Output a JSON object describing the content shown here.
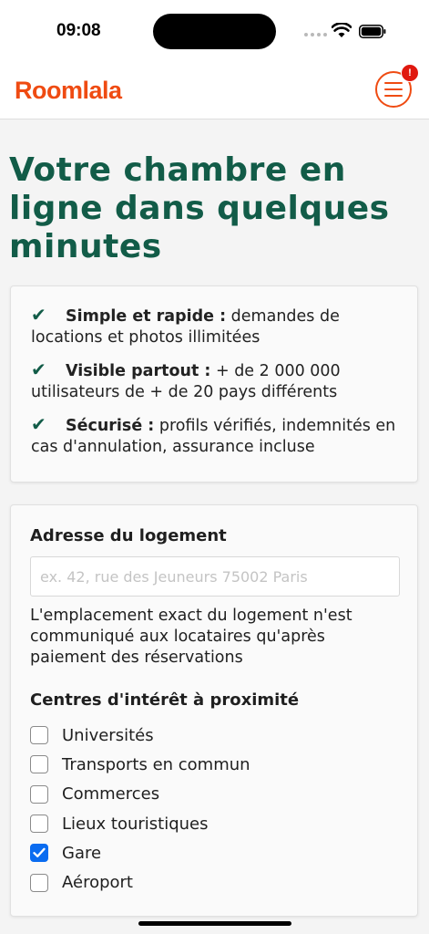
{
  "status_bar": {
    "time": "09:08"
  },
  "header": {
    "logo_text": "Roomlala",
    "notification_count": "!",
    "brand_color": "#ef4b12"
  },
  "page": {
    "title": "Votre chambre en ligne dans quelques minutes",
    "title_color": "#125c48"
  },
  "features": [
    {
      "check": "✔",
      "bold": "Simple et rapide :",
      "text": " demandes de locations et photos illimitées"
    },
    {
      "check": "✔",
      "bold": "Visible partout :",
      "text": " + de 2 000 000 utilisateurs de + de 20 pays différents"
    },
    {
      "check": "✔",
      "bold": "Sécurisé :",
      "text": " profils vérifiés, indemnités en cas d'annulation, assurance incluse"
    }
  ],
  "form": {
    "address_label": "Adresse du logement",
    "address_value": "",
    "address_placeholder": "ex. 42, rue des Jeuneurs 75002 Paris",
    "address_help": "L'emplacement exact du logement n'est communiqué aux locataires qu'après paiement des réservations",
    "poi_label": "Centres d'intérêt à proximité",
    "poi_options": [
      {
        "label": "Universités",
        "checked": false
      },
      {
        "label": "Transports en commun",
        "checked": false
      },
      {
        "label": "Commerces",
        "checked": false
      },
      {
        "label": "Lieux touristiques",
        "checked": false
      },
      {
        "label": "Gare",
        "checked": true
      },
      {
        "label": "Aéroport",
        "checked": false
      }
    ]
  },
  "icons": {
    "menu": "hamburger-icon",
    "wifi": "wifi-icon",
    "battery": "battery-icon",
    "checkmark": "checkmark-icon"
  },
  "colors": {
    "checkbox_checked": "#0a6cf0",
    "background": "#f4f4f4"
  }
}
